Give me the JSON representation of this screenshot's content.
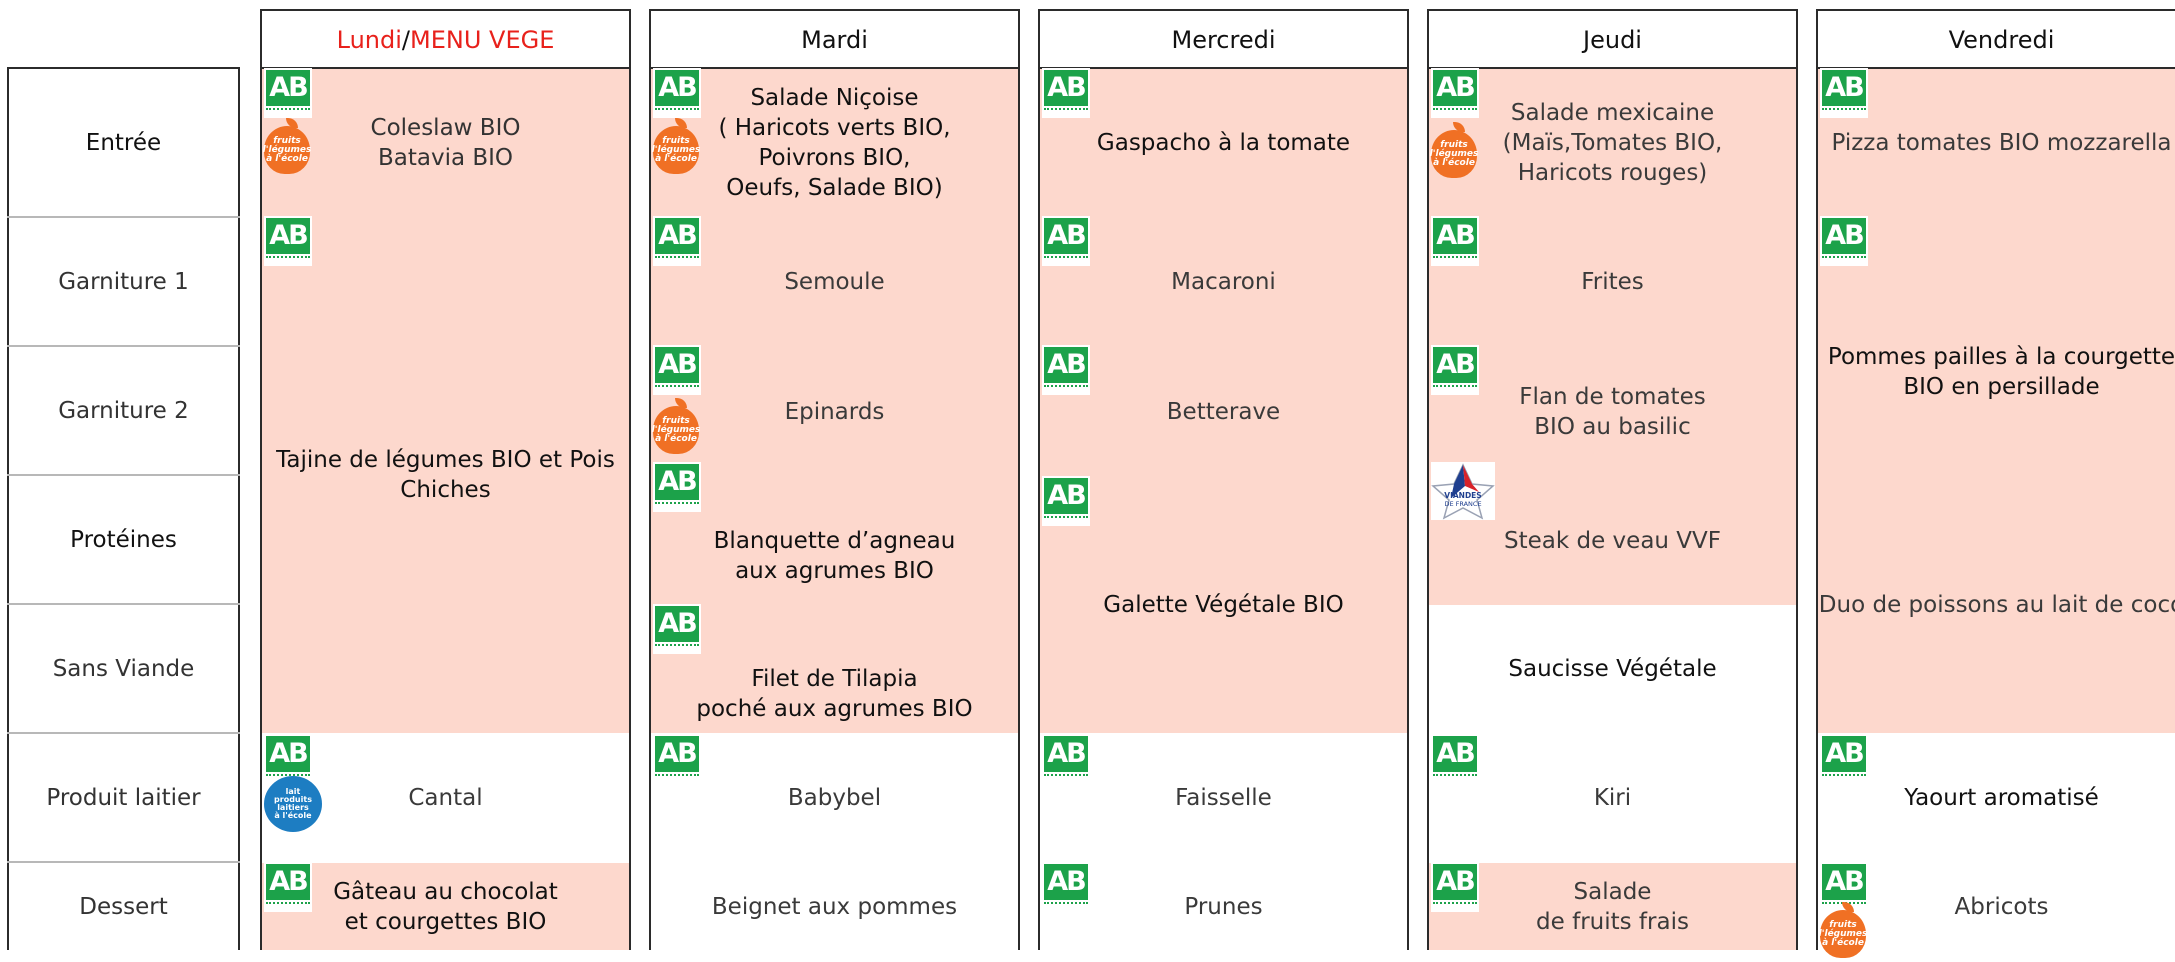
{
  "days": {
    "mon_a": "Lundi",
    "mon_sep": "/",
    "mon_b": "MENU VEGE",
    "tue": "Mardi",
    "wed": "Mercredi",
    "thu": "Jeudi",
    "fri": "Vendredi"
  },
  "rows": {
    "entree": "Entrée",
    "garniture1": "Garniture 1",
    "garniture2": "Garniture 2",
    "proteines": "Protéines",
    "sans_viande": "Sans Viande",
    "produit_laitier": "Produit laitier",
    "dessert": "Dessert"
  },
  "menu": {
    "mon": {
      "entree": "Coleslaw BIO\nBatavia BIO",
      "plat": "Tajine de légumes BIO et Pois\nChiches",
      "laitier": "Cantal",
      "dessert": "Gâteau au chocolat\net courgettes BIO"
    },
    "tue": {
      "entree": "Salade Niçoise\n( Haricots verts BIO,\nPoivrons BIO,\nOeufs, Salade BIO)",
      "garniture1": "Semoule",
      "garniture2": "Epinards",
      "proteines": "Blanquette d’agneau\naux agrumes BIO",
      "sans_viande": "Filet de Tilapia\npoché aux agrumes BIO",
      "laitier": "Babybel",
      "dessert": "Beignet aux pommes"
    },
    "wed": {
      "entree": "Gaspacho à la tomate",
      "garniture1": "Macaroni",
      "garniture2": "Betterave",
      "plat": "Galette Végétale BIO",
      "laitier": "Faisselle",
      "dessert": "Prunes"
    },
    "thu": {
      "entree": "Salade mexicaine\n(Maïs,Tomates BIO,\nHaricots rouges)",
      "garniture1": "Frites",
      "garniture2": "Flan de tomates\nBIO au basilic",
      "proteines": "Steak de veau VVF",
      "sans_viande": "Saucisse Végétale",
      "laitier": "Kiri",
      "dessert": "Salade\nde fruits frais"
    },
    "fri": {
      "entree": "Pizza tomates BIO mozzarella",
      "garniture": "Pommes pailles à la courgette\nBIO en persillade",
      "plat": "Duo de poissons au lait de coco",
      "laitier": "Yaourt aromatisé",
      "dessert": "Abricots"
    }
  },
  "logos": {
    "ab": "AB",
    "fruits": "fruits\nl'légumes\nà l'école",
    "vvf": "VIANDES\nDE FRANCE",
    "lait": "lait\nproduits\nlaitiers\nà l'école"
  },
  "colors": {
    "highlight": "#fdd8cd",
    "red": "#e8211b",
    "bio_green": "#1ca24a",
    "fruit_orange": "#f07024",
    "lait_blue": "#1d7dc2"
  },
  "icons": [
    "ab-bio-icon",
    "fruits-legumes-ecole-icon",
    "viandes-de-france-icon",
    "lait-ecole-icon"
  ]
}
